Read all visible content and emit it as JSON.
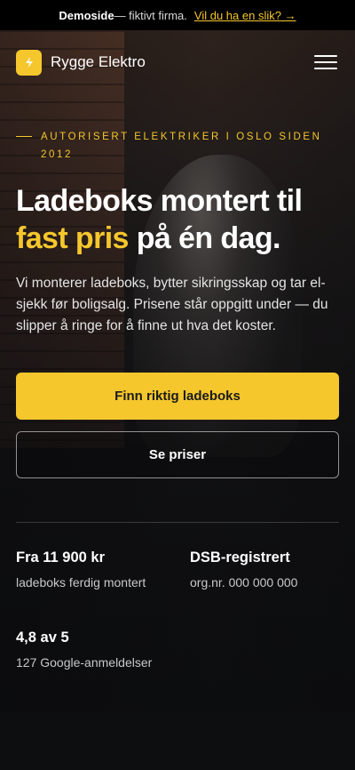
{
  "banner": {
    "label": "Demoside",
    "text": " — fiktivt firma. ",
    "link": "Vil du ha en slik? →"
  },
  "nav": {
    "brand": "Rygge Elektro",
    "logo_icon": "lightning-icon",
    "menu_icon": "hamburger-menu-icon"
  },
  "hero": {
    "eyebrow": "Autorisert elektriker i Oslo siden 2012",
    "headline_part1": "Ladeboks montert til ",
    "headline_highlight": "fast pris",
    "headline_part2": " på én dag.",
    "lead": "Vi monterer ladeboks, bytter sikringsskap og tar el-sjekk før boligsalg. Prisene står oppgitt under — du slipper å ringe for å finne ut hva det koster.",
    "primary_cta": "Finn riktig ladeboks",
    "secondary_cta": "Se priser"
  },
  "stats": [
    {
      "value": "Fra 11 900 kr",
      "label": "ladeboks ferdig montert"
    },
    {
      "value": "DSB-registrert",
      "label": "org.nr. 000 000 000"
    },
    {
      "value": "4,8 av 5",
      "label": "127 Google-anmeldelser"
    }
  ],
  "colors": {
    "accent": "#f5c72d",
    "background": "#0d0e10"
  }
}
